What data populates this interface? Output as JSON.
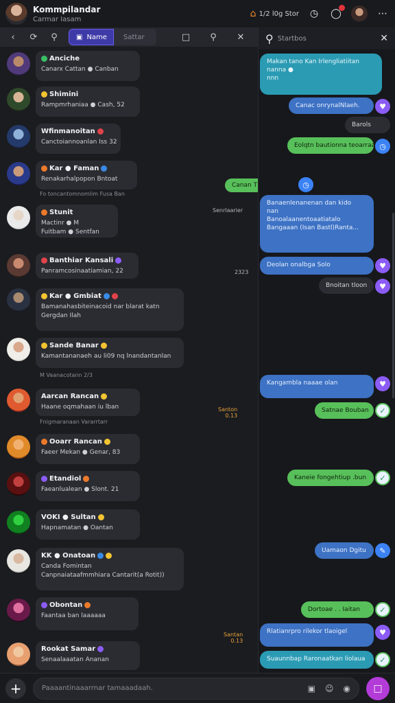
{
  "header": {
    "title": "Kommpilandar",
    "subtitle": "Carmar Iasam",
    "status": "1/2 l0g Stor",
    "colors": {
      "accent": "#3e3aa8",
      "send": "#b33bd8",
      "green": "#58c05a",
      "blue": "#3d72c4",
      "teal": "#2b9bb4"
    }
  },
  "toolbar": {
    "tab_active": "Name",
    "tab_inactive": "Sattar"
  },
  "chat_header": {
    "label": "Startbos"
  },
  "conversations": [
    {
      "name": "Anciche",
      "line1": "Canarx Cattan ● Canban",
      "sub": "",
      "time": ""
    },
    {
      "name": "Shimini",
      "line1": "Rampmrhaniaa ● Cash, 52",
      "sub": "",
      "time": ""
    },
    {
      "name": "Wfinmanoitan",
      "line1": "Canctoiannoanlan Iss 32",
      "sub": "",
      "time": ""
    },
    {
      "name": "Kar ● Faman",
      "line1": "Renakarhalpopon Bntoat",
      "sub": "Fo toncantomnomlim  Fusa Ban",
      "time": ""
    },
    {
      "name": "Stunit",
      "line1": "Mactinr ● M",
      "line2": "Fuitbam ● Sentfan",
      "sub": "",
      "time": "Senrlaarier"
    },
    {
      "name": "Banthiar Kansali",
      "line1": "Panramcosinaatiamian, 22",
      "sub": "",
      "time": "2323"
    },
    {
      "name": "Kar ● Gmbiat",
      "line1": "Bamanahasbiteinacoid nar blarat katn",
      "line2": "Gergdan Ilah",
      "sub": "",
      "time": ""
    },
    {
      "name": "Sande Banar",
      "line1": "Kamantananaeh au li09 nq lnandantanlan",
      "sub": "M Vaanacotann  2/3",
      "time": ""
    },
    {
      "name": "Aarcan Rancan",
      "line1": "Haane oqmahaan iu lban",
      "sub": "Fnigmaranaan  Vararrtarr",
      "time": "Santon\n0.13"
    },
    {
      "name": "Ooarr Rancan",
      "line1": "Faeer Mekan ● Genar, 83",
      "sub": "",
      "time": ""
    },
    {
      "name": "Etandiol",
      "line1": "Faeanlualean ● Slont. 21",
      "sub": "",
      "time": ""
    },
    {
      "name": "VOKI ● Sultan",
      "line1": "Hapnamatan ● Oantan",
      "sub": "",
      "time": ""
    },
    {
      "name": "KK ● Onatoan",
      "line1": "Canda Fomintan",
      "line2": "Canpnaiataafmmhiara Cantarit(a Rotit))",
      "sub": "",
      "time": ""
    },
    {
      "name": "Obontan",
      "line1": "Faantaa ban laaaaaa",
      "sub": "",
      "time": "Santan\n0.13"
    },
    {
      "name": "Rookat Samar",
      "line1": "Senaalaaatan Ananan",
      "sub": "",
      "time": ""
    }
  ],
  "messages": [
    {
      "text": "Makan tano Kan Irlengliatiitan\nnanna ●\nnnn",
      "kind": "teal"
    },
    {
      "text": "Canac onrynalNlaeh.",
      "kind": "blue"
    },
    {
      "text": "Barols",
      "kind": "dark"
    },
    {
      "text": "Eolqtn bautionna teoarraa",
      "kind": "green"
    },
    {
      "text": "Canan  Tlaan | l",
      "kind": "green"
    },
    {
      "text": "Banaenlenanenan dan kido\nnan\nBanoalaanentoaatiatalo\nBangaaan (Isan Bastl)Ranta...",
      "kind": "blue"
    },
    {
      "text": "Deolan onalbga      Solo",
      "kind": "blue"
    },
    {
      "text": "Bnoitan tloon",
      "kind": "dark"
    },
    {
      "text": "Kangambla naaae olan",
      "kind": "blue"
    },
    {
      "text": "Satnae Bouban",
      "kind": "green"
    },
    {
      "text": "Kaneie fongehtiup .bun",
      "kind": "green"
    },
    {
      "text": "Uamaon Dgitu",
      "kind": "blue"
    },
    {
      "text": "Dortoae . .  Iaitan",
      "kind": "green"
    },
    {
      "text": "Rlatianrpro rilekor tlaoigel",
      "kind": "blue"
    },
    {
      "text": "Suaunnbap Raronaatkan liolaua",
      "kind": "teal"
    }
  ],
  "composer": {
    "placeholder": "Paaaantinaaarrnar tamaaadaah."
  }
}
